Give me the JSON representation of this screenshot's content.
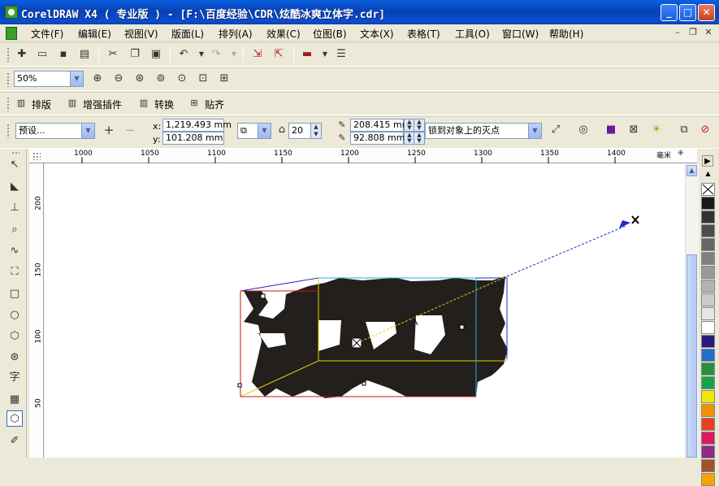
{
  "window": {
    "title": "CorelDRAW X4 ( 专业版 ) - [F:\\百度经验\\CDR\\炫酷冰爽立体字.cdr]",
    "minimize_glyph": "_",
    "maximize_glyph": "□",
    "close_glyph": "✕"
  },
  "menu": [
    {
      "label": "文件(F)"
    },
    {
      "label": "编辑(E)"
    },
    {
      "label": "视图(V)"
    },
    {
      "label": "版面(L)"
    },
    {
      "label": "排列(A)"
    },
    {
      "label": "效果(C)"
    },
    {
      "label": "位图(B)"
    },
    {
      "label": "文本(X)"
    },
    {
      "label": "表格(T)"
    },
    {
      "label": "工具(O)"
    },
    {
      "label": "窗口(W)"
    },
    {
      "label": "帮助(H)"
    }
  ],
  "mdi": {
    "minimize": "–",
    "restore": "❐",
    "close": "✕"
  },
  "zoom": {
    "value": "50%"
  },
  "plugins": {
    "paiban": "排版",
    "zengqiang": "增强插件",
    "zhuanhuan": "转换",
    "tiehe": "贴齐"
  },
  "property": {
    "preset": "预设...",
    "x_label": "x:",
    "y_label": "y:",
    "x_value": "1,219.493 mm",
    "y_value": "101.208 mm",
    "depth_value": "20",
    "vp_x": "208.415 mm",
    "vp_y": "92.808 mm",
    "lock_mode": "锁到对象上的灭点"
  },
  "ruler": {
    "unit": "毫米",
    "h_labels": [
      "1000",
      "1050",
      "1100",
      "1150",
      "1200",
      "1250",
      "1300",
      "1350",
      "1400"
    ],
    "v_labels": [
      "200",
      "150",
      "100",
      "50"
    ]
  },
  "icons": {
    "toolbox": [
      "pick-tool-icon",
      "shape-tool-icon",
      "crop-tool-icon",
      "zoom-tool-icon",
      "freehand-tool-icon",
      "smart-fill-icon",
      "rectangle-tool-icon",
      "ellipse-tool-icon",
      "polygon-tool-icon",
      "basic-shapes-icon",
      "text-tool-icon",
      "table-tool-icon",
      "extrude-tool-icon",
      "eyedropper-tool-icon"
    ]
  },
  "tools": {
    "text_glyph": "字"
  },
  "palette": {
    "colors": [
      "#1a1a1a",
      "#333333",
      "#4d4d4d",
      "#666666",
      "#808080",
      "#999999",
      "#b3b3b3",
      "#cccccc",
      "#e6e6e6",
      "#ffffff",
      "#2b1a7a",
      "#1f6fcf",
      "#2a8f3f",
      "#17a34a",
      "#f5e400",
      "#f29100",
      "#e8401c",
      "#d81b60",
      "#8e2a8a",
      "#a0522d",
      "#f6a300"
    ]
  }
}
